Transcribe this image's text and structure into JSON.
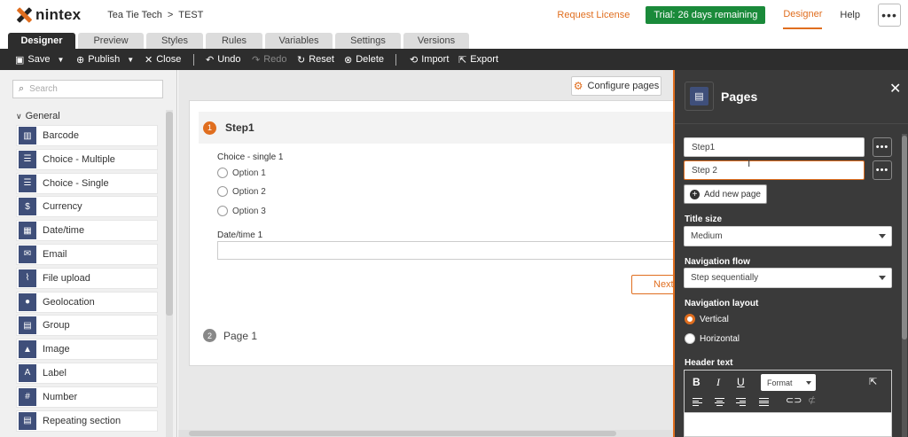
{
  "app": {
    "logo_text": "nintex"
  },
  "breadcrumb": {
    "workspace": "Tea Tie Tech",
    "separator": ">",
    "form": "TEST"
  },
  "topnav": {
    "request_license": "Request License",
    "trial": "Trial: 26 days remaining",
    "designer": "Designer",
    "help": "Help",
    "more": "•••"
  },
  "tabs": [
    {
      "label": "Designer",
      "active": true
    },
    {
      "label": "Preview"
    },
    {
      "label": "Styles"
    },
    {
      "label": "Rules"
    },
    {
      "label": "Variables"
    },
    {
      "label": "Settings"
    },
    {
      "label": "Versions"
    }
  ],
  "toolbar": {
    "save": "Save",
    "publish": "Publish",
    "close": "Close",
    "undo": "Undo",
    "redo": "Redo",
    "reset": "Reset",
    "delete": "Delete",
    "import": "Import",
    "export": "Export"
  },
  "left_panel": {
    "search_placeholder": "Search",
    "section": "General",
    "items": [
      {
        "label": "Barcode",
        "icon": "barcode-icon",
        "glyph": "▥"
      },
      {
        "label": "Choice - Multiple",
        "icon": "checklist-icon",
        "glyph": "☰"
      },
      {
        "label": "Choice - Single",
        "icon": "radio-list-icon",
        "glyph": "☰"
      },
      {
        "label": "Currency",
        "icon": "currency-icon",
        "glyph": "$"
      },
      {
        "label": "Date/time",
        "icon": "calendar-icon",
        "glyph": "▦"
      },
      {
        "label": "Email",
        "icon": "envelope-icon",
        "glyph": "✉"
      },
      {
        "label": "File upload",
        "icon": "paperclip-icon",
        "glyph": "⌇"
      },
      {
        "label": "Geolocation",
        "icon": "map-pin-icon",
        "glyph": "●"
      },
      {
        "label": "Group",
        "icon": "group-icon",
        "glyph": "▤"
      },
      {
        "label": "Image",
        "icon": "image-icon",
        "glyph": "▲"
      },
      {
        "label": "Label",
        "icon": "label-icon",
        "glyph": "A"
      },
      {
        "label": "Number",
        "icon": "number-icon",
        "glyph": "#"
      },
      {
        "label": "Repeating section",
        "icon": "repeat-icon",
        "glyph": "▤"
      }
    ]
  },
  "canvas": {
    "configure_pages": "Configure pages",
    "step1": {
      "number": "1",
      "title": "Step1"
    },
    "choice_label": "Choice - single 1",
    "options": [
      "Option 1",
      "Option 2",
      "Option 3"
    ],
    "date_label": "Date/time 1",
    "next": "Next",
    "step2": {
      "number": "2",
      "title": "Page 1"
    }
  },
  "right_panel": {
    "title": "Pages",
    "close": "✕",
    "pages": [
      "Step1",
      "Step 2"
    ],
    "page_more": "•••",
    "add_new_page": "Add new page",
    "title_size_label": "Title size",
    "title_size_value": "Medium",
    "navigation_flow_label": "Navigation flow",
    "navigation_flow_value": "Step sequentially",
    "navigation_layout_label": "Navigation layout",
    "layout_options": [
      {
        "label": "Vertical",
        "checked": true
      },
      {
        "label": "Horizontal",
        "checked": false
      }
    ],
    "header_text_label": "Header text",
    "editor": {
      "bold": "B",
      "italic": "I",
      "underline": "U",
      "format": "Format"
    }
  },
  "colors": {
    "accent": "#e06e1f",
    "dark": "#2d2d2d",
    "panel": "#3a3a3a",
    "trial": "#1a8a3a",
    "icon_bg": "#3f4f7a"
  }
}
